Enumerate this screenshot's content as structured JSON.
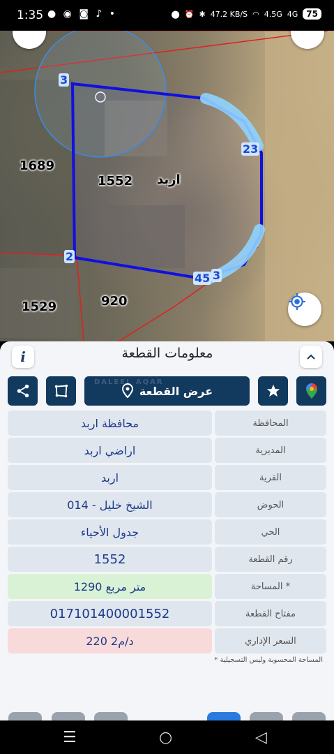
{
  "status_bar": {
    "time": "1:35",
    "left_icons": [
      "message-icon",
      "chat-icon",
      "instagram-icon",
      "tiktok-icon",
      "dot-icon"
    ],
    "net_speed": "47.2 KB/S",
    "network_1": "4.5G",
    "network_2": "4G",
    "battery": "75"
  },
  "map": {
    "plot_labels": {
      "parcel_1689": "1689",
      "parcel_1552": "1552",
      "parcel_irbid": "اربد",
      "parcel_1529": "1529",
      "parcel_920": "920"
    },
    "vertex_labels": {
      "v3": "3",
      "v23": "23",
      "v2": "2",
      "v45": "45",
      "v3b": "3"
    }
  },
  "panel": {
    "title": "معلومات القطعة",
    "show_plot_label": "عرض القطعة",
    "watermark": "DALEEL AQAR",
    "rows": [
      {
        "label": "المحافظة",
        "value": "محافظة اربد"
      },
      {
        "label": "المديرية",
        "value": "اراضي اربد"
      },
      {
        "label": "القرية",
        "value": "اربد"
      },
      {
        "label": "الحوض",
        "value": "الشيخ خليل - 014"
      },
      {
        "label": "الحي",
        "value": "جدول الأحياء"
      },
      {
        "label": "رقم القطعة",
        "value": "1552"
      },
      {
        "label": "المساحة *",
        "value": "1290  متر مربع"
      },
      {
        "label": "مفتاح القطعة",
        "value": "017101400001552"
      },
      {
        "label": "السعر الإداري",
        "value": "220 د/م2"
      }
    ],
    "footnote": "* المساحة المحسوبة وليس التسجيلية"
  },
  "colors": {
    "primary": "#123a5e",
    "boundary_blue": "#1010e0",
    "parcel_red": "#e02020",
    "area_green": "#d9f2d6",
    "price_red": "#f9dada"
  }
}
